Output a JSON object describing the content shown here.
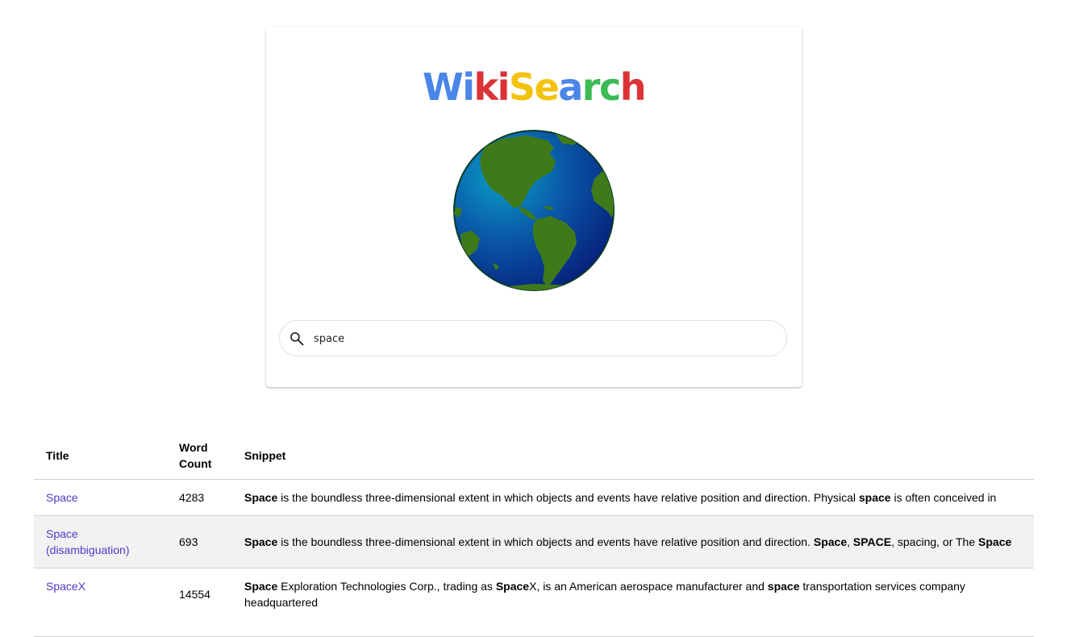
{
  "logo": {
    "letters": [
      {
        "char": "W",
        "color": "#4a86e8"
      },
      {
        "char": "i",
        "color": "#4a86e8"
      },
      {
        "char": "k",
        "color": "#db3236"
      },
      {
        "char": "i",
        "color": "#db3236"
      },
      {
        "char": "S",
        "color": "#f4c20d"
      },
      {
        "char": "e",
        "color": "#f4c20d"
      },
      {
        "char": "a",
        "color": "#4a86e8"
      },
      {
        "char": "r",
        "color": "#3cba54"
      },
      {
        "char": "c",
        "color": "#3cba54"
      },
      {
        "char": "h",
        "color": "#db3236"
      }
    ]
  },
  "globe": {
    "icon": "globe-americas-icon",
    "ocean_color": "#0a3a8c",
    "land_color": "#3f7a1a"
  },
  "search": {
    "icon": "search-icon",
    "value": "space",
    "placeholder": ""
  },
  "table": {
    "headers": {
      "title": "Title",
      "word_count": "Word Count",
      "snippet": "Snippet"
    },
    "rows": [
      {
        "title": "Space",
        "word_count": "4283",
        "snippet": [
          {
            "text": "Space",
            "bold": true
          },
          {
            "text": " is the boundless three-dimensional extent in which objects and events have relative position and direction. Physical ",
            "bold": false
          },
          {
            "text": "space",
            "bold": true
          },
          {
            "text": " is often conceived in",
            "bold": false
          }
        ]
      },
      {
        "title": "Space (disambiguation)",
        "word_count": "693",
        "snippet": [
          {
            "text": "Space",
            "bold": true
          },
          {
            "text": " is the boundless three-dimensional extent in which objects and events have relative position and direction. ",
            "bold": false
          },
          {
            "text": "Space",
            "bold": true
          },
          {
            "text": ", ",
            "bold": false
          },
          {
            "text": "SPACE",
            "bold": true
          },
          {
            "text": ", spacing, or The ",
            "bold": false
          },
          {
            "text": "Space",
            "bold": true
          }
        ]
      },
      {
        "title": "SpaceX",
        "word_count": "14554",
        "snippet": [
          {
            "text": "Space",
            "bold": true
          },
          {
            "text": " Exploration Technologies Corp., trading as ",
            "bold": false
          },
          {
            "text": "Space",
            "bold": true
          },
          {
            "text": "X, is an American aerospace manufacturer and ",
            "bold": false
          },
          {
            "text": "space",
            "bold": true
          },
          {
            "text": " transportation services company headquartered",
            "bold": false
          }
        ]
      }
    ]
  },
  "colors": {
    "link": "#4b3bc9",
    "row_alt_bg": "#f2f2f2",
    "divider": "#d0d0d0"
  }
}
